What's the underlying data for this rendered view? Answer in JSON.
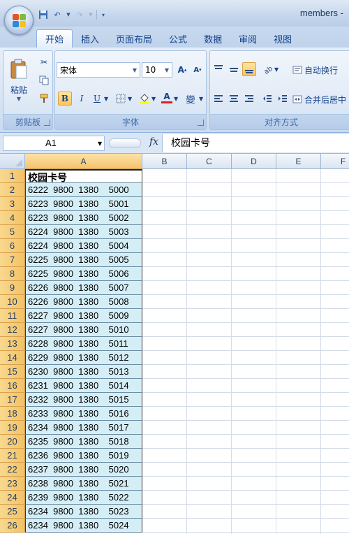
{
  "window": {
    "title": "members -"
  },
  "tabs": [
    "开始",
    "插入",
    "页面布局",
    "公式",
    "数据",
    "审阅",
    "视图"
  ],
  "active_tab": "开始",
  "ribbon": {
    "clipboard": {
      "paste_label": "粘贴",
      "group_label": "剪贴板"
    },
    "font": {
      "name": "宋体",
      "size": "10",
      "grow": "A",
      "shrink": "A",
      "bold": "B",
      "italic": "I",
      "underline": "U",
      "color_letter": "A",
      "phonetic": "變",
      "group_label": "字体"
    },
    "alignment": {
      "wrap_text": "自动换行",
      "merge_center": "合并后居中",
      "group_label": "对齐方式"
    }
  },
  "formula_bar": {
    "name_box": "A1",
    "fx": "fx",
    "content": "校园卡号"
  },
  "sheet": {
    "columns": [
      "A",
      "B",
      "C",
      "D",
      "E",
      "F"
    ],
    "selected_column": "A",
    "rows": [
      "1",
      "2",
      "3",
      "4",
      "5",
      "6",
      "7",
      "8",
      "9",
      "10",
      "11",
      "12",
      "13",
      "14",
      "15",
      "16",
      "17",
      "18",
      "19",
      "20",
      "21",
      "22",
      "23",
      "24",
      "25",
      "26"
    ],
    "cells_a": [
      "校园卡号",
      "6222  9800  1380    5000",
      "6223  9800  1380    5001",
      "6223  9800  1380    5002",
      "6224  9800  1380    5003",
      "6224  9800  1380    5004",
      "6225  9800  1380    5005",
      "6225  9800  1380    5006",
      "6226  9800  1380    5007",
      "6226  9800  1380    5008",
      "6227  9800  1380    5009",
      "6227  9800  1380    5010",
      "6228  9800  1380    5011",
      "6229  9800  1380    5012",
      "6230  9800  1380    5013",
      "6231  9800  1380    5014",
      "6232  9800  1380    5015",
      "6233  9800  1380    5016",
      "6234  9800  1380    5017",
      "6235  9800  1380    5018",
      "6236  9800  1380    5019",
      "6237  9800  1380    5020",
      "6238  9800  1380    5021",
      "6239  9800  1380    5022",
      "6234  9800  1380    5023",
      "6234  9800  1380    5024"
    ]
  },
  "colors": {
    "cell_fill": "#d5eef6",
    "row_header_selected": "#f3c165",
    "ribbon": "#dbe6f4"
  }
}
